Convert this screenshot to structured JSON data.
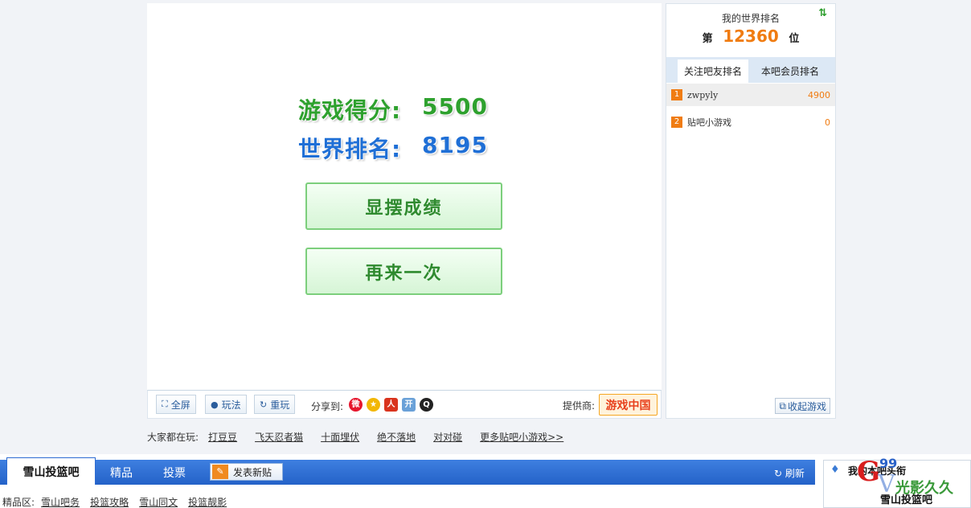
{
  "game": {
    "score_label": "游戏得分:",
    "score_value": "5500",
    "rank_label": "世界排名:",
    "rank_value": "8195",
    "btn_show": "显摆成绩",
    "btn_again": "再来一次"
  },
  "toolbar": {
    "full": "全屏",
    "howto": "玩法",
    "replay": "重玩",
    "share_label": "分享到:",
    "provider_label": "提供商:",
    "provider_name": "游戏中国"
  },
  "playing": {
    "label": "大家都在玩:",
    "games": [
      "打豆豆",
      "飞天忍者猫",
      "十面埋伏",
      "绝不落地",
      "对对碰",
      "更多贴吧小游戏>>"
    ]
  },
  "rank_panel": {
    "title": "我的世界排名",
    "prefix": "第",
    "value": "12360",
    "suffix": "位",
    "tabs": [
      "关注吧友排名",
      "本吧会员排名"
    ],
    "rows": [
      {
        "rank": "1",
        "name": "zwpyly",
        "points": "4900"
      },
      {
        "rank": "2",
        "name": "贴吧小游戏",
        "points": "0"
      }
    ],
    "collapse": "收起游戏"
  },
  "forum": {
    "name": "雪山投篮吧",
    "tabs": [
      "精品",
      "投票"
    ],
    "post": "发表新贴",
    "refresh": "刷新",
    "jingpin_label": "精品区:",
    "jingpin_items": [
      "雪山吧务",
      "投篮攻略",
      "雪山同文",
      "投篮靓影"
    ],
    "headline_title": "我的本吧头衔",
    "headline_sub": "雪山投篮吧"
  },
  "colors": {
    "score": "#2ea12e",
    "rank": "#1f6fd6",
    "accent": "#f07c12",
    "bar": "#2462c8"
  },
  "watermark": {
    "text": "光影久久",
    "badge": "99"
  }
}
